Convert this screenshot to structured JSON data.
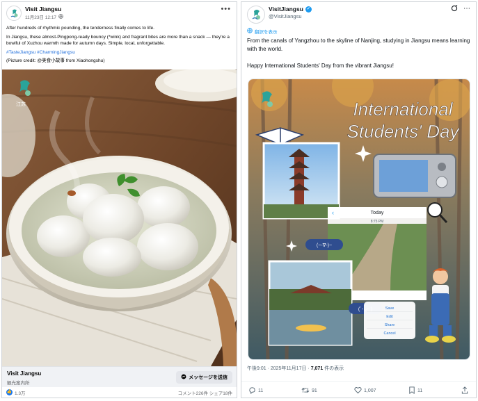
{
  "facebook": {
    "page_name": "Visit Jiangsu",
    "timestamp": "11月23日 12:17",
    "text_line1": "After hundreds of rhythmic pounding, the tenderness finally comes to life.",
    "text_line2": "In Jiangsu, these almost-Pingpong-ready bouncy (*wink) and fragrant bites are more than a snack — they're a bowlful of Xuzhou warmth made for autumn days. Simple, local, unforgettable.",
    "hashtags": "#TasteJiangsu #CharmingJiangsu",
    "credit": "(Picture credit: @美食小故事 from Xiaohongshu)",
    "footer_name": "Visit Jiangsu",
    "footer_sub": "観光案内所",
    "message_button": "メッセージを送信",
    "likes": "1.3万",
    "counts": "コメント226件  シェア18件"
  },
  "twitter": {
    "display_name": "VisitJiangsu",
    "handle": "@VisitJiangsu",
    "translate": "翻訳を表示",
    "body_line1": "From the canals of Yangzhou to the skyline of Nanjing, studying in Jiangsu means learning with the world.",
    "body_line2": "Happy International Students' Day from the vibrant Jiangsu!",
    "image_title_1": "International",
    "image_title_2": "Students' Day",
    "phone_label": "Today",
    "phone_time": "8:75 PM",
    "emoticon_1": "(~-∇-)~",
    "emoticon_2": "(´･ᴗ･`)",
    "menu_items": [
      "Save",
      "Edit",
      "Share",
      "Cancel"
    ],
    "time_prefix": "午後9:01 · 2025年11月17日 · ",
    "views": "7,071",
    "views_suffix": " 件の表示",
    "replies": "11",
    "reposts": "91",
    "likes": "1,007",
    "bookmarks": "11"
  }
}
